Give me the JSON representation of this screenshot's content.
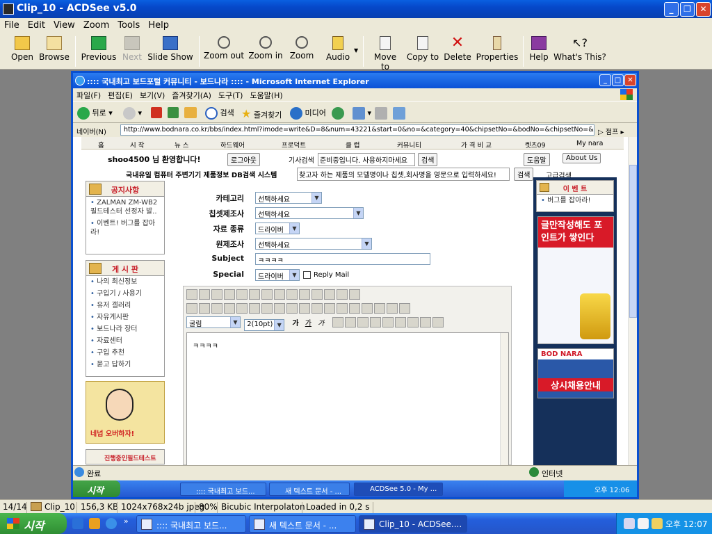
{
  "window": {
    "title": "Clip_10 - ACDSee v5.0"
  },
  "menu": [
    "File",
    "Edit",
    "View",
    "Zoom",
    "Tools",
    "Help"
  ],
  "toolbar": {
    "open": "Open",
    "browse": "Browse",
    "previous": "Previous",
    "next": "Next",
    "slideshow": "Slide Show",
    "zoomout": "Zoom out",
    "zoomin": "Zoom in",
    "zoom": "Zoom",
    "audio": "Audio",
    "moveto": "Move to",
    "copyto": "Copy to",
    "delete": "Delete",
    "properties": "Properties",
    "help": "Help",
    "whatsthis": "What's This?"
  },
  "ie": {
    "title": ":::: 국내최고 보드포털 커뮤니티 - 보드나라 :::: - Microsoft Internet Explorer",
    "menu": [
      "파일(F)",
      "편집(E)",
      "보기(V)",
      "즐겨찾기(A)",
      "도구(T)",
      "도움말(H)"
    ],
    "buttons": {
      "back": "뒤로",
      "search": "검색",
      "favorites": "즐겨찾기",
      "media": "미디어"
    },
    "address_label": "네이버(N)",
    "address": "http://www.bodnara.co.kr/bbs/index.html?imode=write&D=8&num=43221&start=0&no=&category=40&chipsetNo=&bodNo=&chipsetNo=&shopcatego",
    "go": "점프",
    "status": "완료",
    "zone": "인터넷"
  },
  "site": {
    "nav": [
      "홈",
      "시 작",
      "뉴 스",
      "하드웨어",
      "프로덕트",
      "클 럽",
      "커뮤니티",
      "가 격 비 교",
      "렛츠09",
      "My nara"
    ],
    "welcome": "shoo4500 님 환영합니다!",
    "logout": "로그아웃",
    "article_search_label": "기사검색",
    "article_search_value": "준비중입니다. 사용하지마세요",
    "search_btn": "검색",
    "help_btn": "도움말",
    "about_btn": "About Us",
    "db_search_label": "국내유일 컴퓨터 주변기기 제품정보 DB검색 시스템",
    "db_search_value": "찾고자 하는 제품의 모델명이나 칩셋,회사명을 영문으로 입력하세요!",
    "db_search_btn": "검색",
    "advanced": "고급검색",
    "notice": {
      "title": "공지사항",
      "items": [
        "ZALMAN ZM-WB2 필드테스터 선정자 발..",
        "이벤트! 버그를 잡아라!"
      ]
    },
    "board": {
      "title": "게 시 판",
      "items": [
        "나의 최신정보",
        "구입기 / 사용기",
        "유저 갤러리",
        "자유게시판",
        "보드나라 장터",
        "자료센터",
        "구입 추천",
        "묻고 답하기"
      ]
    },
    "banner_text": "네넘 오버하자!",
    "fieldtest": "진행중인필드테스트",
    "form": {
      "category_label": "카테고리",
      "category_value": "선택하세요",
      "chipset_label": "칩셋제조사",
      "chipset_value": "선택하세요",
      "type_label": "자료 종류",
      "type_value": "드라이버",
      "maker_label": "원제조사",
      "maker_value": "선택하세요",
      "subject_label": "Subject",
      "subject_value": "ㅋㅋㅋㅋ",
      "special_label": "Special",
      "special_value": "드라이버",
      "reply_mail": "Reply Mail"
    },
    "editor": {
      "font": "굴림",
      "size": "2(10pt)",
      "content": "ㅋㅋㅋㅋ"
    },
    "event": {
      "title": "이 벤 트",
      "item": "버그를 잡아라!"
    },
    "ad1_text": "글만작성해도 포인트가 쌓인다",
    "ad2_text": "상시채용안내",
    "ad2_brand": "BOD NARA"
  },
  "inner_taskbar": {
    "start": "시작",
    "tasks": [
      ":::: 국내최고 보드...",
      "새 텍스트 문서 - ...",
      "ACDSee 5.0 - My ..."
    ],
    "clock": "오후 12:06"
  },
  "status": {
    "index": "14/14",
    "file": "Clip_10",
    "size": "156,3 KB",
    "dims": "1024x768x24b jpeg",
    "zoom": "80%",
    "interp": "Bicubic Interpolaton",
    "loaded": "Loaded in 0,2 s"
  },
  "taskbar": {
    "start": "시작",
    "tasks": [
      ":::: 국내최고 보드...",
      "새 텍스트 문서 - ...",
      "Clip_10 - ACDSee...."
    ],
    "clock": "오후 12:07"
  },
  "colors": {
    "xp_blue": "#0a5fe0",
    "start_green": "#3a9a3c",
    "site_red": "#c8202a",
    "sidebar_navy": "#15305a"
  }
}
